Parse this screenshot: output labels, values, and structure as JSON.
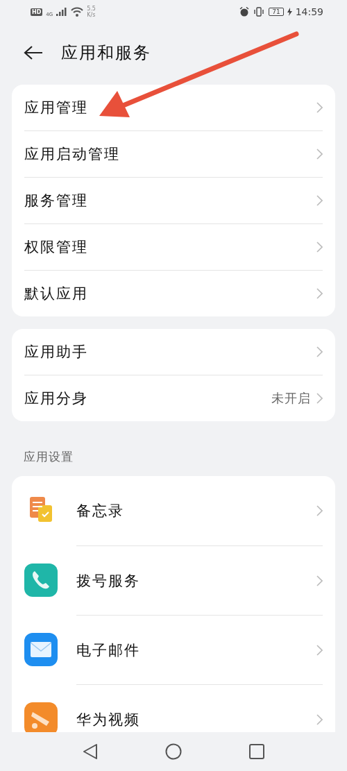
{
  "status_bar": {
    "hd": "HD",
    "network": "4G",
    "speed": "5.5",
    "speed_unit": "K/s",
    "battery": "71",
    "time": "14:59"
  },
  "header": {
    "title": "应用和服务"
  },
  "groups": [
    {
      "items": [
        {
          "label": "应用管理"
        },
        {
          "label": "应用启动管理"
        },
        {
          "label": "服务管理"
        },
        {
          "label": "权限管理"
        },
        {
          "label": "默认应用"
        }
      ]
    },
    {
      "items": [
        {
          "label": "应用助手"
        },
        {
          "label": "应用分身",
          "value": "未开启"
        }
      ]
    }
  ],
  "section": {
    "title": "应用设置"
  },
  "apps": [
    {
      "label": "备忘录",
      "kind": "notes"
    },
    {
      "label": "拨号服务",
      "kind": "phone"
    },
    {
      "label": "电子邮件",
      "kind": "mail"
    },
    {
      "label": "华为视频",
      "kind": "video"
    }
  ],
  "annotation": {
    "kind": "arrow"
  }
}
